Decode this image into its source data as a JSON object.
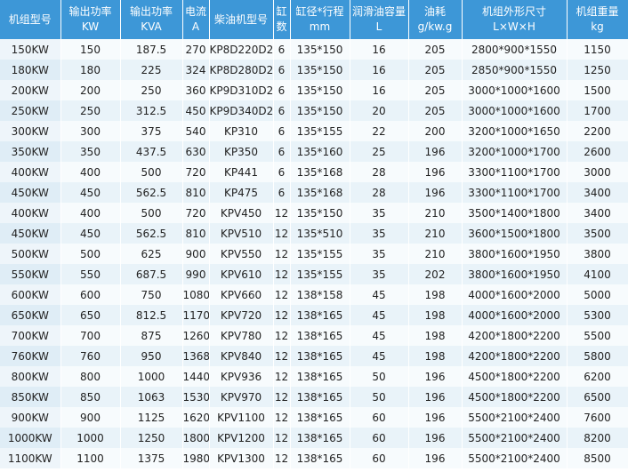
{
  "headers": [
    {
      "l1": "机组型号",
      "l2": ""
    },
    {
      "l1": "输出功率",
      "l2": "KW"
    },
    {
      "l1": "输出功率",
      "l2": "KVA"
    },
    {
      "l1": "电流",
      "l2": "A"
    },
    {
      "l1": "柴油机型号",
      "l2": ""
    },
    {
      "l1": "缸",
      "l2": "数"
    },
    {
      "l1": "缸径*行程",
      "l2": "mm"
    },
    {
      "l1": "润滑油容量",
      "l2": "L"
    },
    {
      "l1": "油耗",
      "l2": "g/kw.g"
    },
    {
      "l1": "机组外形尺寸",
      "l2": "L×W×H"
    },
    {
      "l1": "机组重量",
      "l2": "kg"
    }
  ],
  "rows": [
    [
      "150KW",
      "150",
      "187.5",
      "270",
      "KP8D220D2",
      "6",
      "135*150",
      "16",
      "205",
      "2800*900*1550",
      "1150"
    ],
    [
      "180KW",
      "180",
      "225",
      "324",
      "KP8D280D2",
      "6",
      "135*150",
      "16",
      "205",
      "2850*900*1550",
      "1250"
    ],
    [
      "200KW",
      "200",
      "250",
      "360",
      "KP9D310D2",
      "6",
      "135*150",
      "16",
      "205",
      "3000*1000*1600",
      "1500"
    ],
    [
      "250KW",
      "250",
      "312.5",
      "450",
      "KP9D340D2",
      "6",
      "135*150",
      "20",
      "205",
      "3000*1000*1600",
      "1700"
    ],
    [
      "300KW",
      "300",
      "375",
      "540",
      "KP310",
      "6",
      "135*155",
      "22",
      "200",
      "3200*1000*1650",
      "2200"
    ],
    [
      "350KW",
      "350",
      "437.5",
      "630",
      "KP350",
      "6",
      "135*160",
      "25",
      "196",
      "3200*1000*1700",
      "2600"
    ],
    [
      "400KW",
      "400",
      "500",
      "720",
      "KP441",
      "6",
      "135*168",
      "28",
      "196",
      "3300*1100*1700",
      "3000"
    ],
    [
      "450KW",
      "450",
      "562.5",
      "810",
      "KP475",
      "6",
      "135*168",
      "28",
      "196",
      "3300*1100*1700",
      "3400"
    ],
    [
      "400KW",
      "400",
      "500",
      "720",
      "KPV450",
      "12",
      "135*150",
      "35",
      "210",
      "3500*1400*1800",
      "3400"
    ],
    [
      "450KW",
      "450",
      "562.5",
      "810",
      "KPV510",
      "12",
      "135*510",
      "35",
      "210",
      "3600*1500*1800",
      "3500"
    ],
    [
      "500KW",
      "500",
      "625",
      "900",
      "KPV550",
      "12",
      "135*155",
      "35",
      "210",
      "3800*1600*1950",
      "3800"
    ],
    [
      "550KW",
      "550",
      "687.5",
      "990",
      "KPV610",
      "12",
      "135*155",
      "35",
      "202",
      "3800*1600*1950",
      "4100"
    ],
    [
      "600KW",
      "600",
      "750",
      "1080",
      "KPV660",
      "12",
      "138*158",
      "45",
      "198",
      "4000*1600*2000",
      "5000"
    ],
    [
      "650KW",
      "650",
      "812.5",
      "1170",
      "KPV720",
      "12",
      "138*165",
      "45",
      "198",
      "4000*1600*2000",
      "5300"
    ],
    [
      "700KW",
      "700",
      "875",
      "1260",
      "KPV780",
      "12",
      "138*165",
      "45",
      "198",
      "4200*1800*2200",
      "5500"
    ],
    [
      "760KW",
      "760",
      "950",
      "1368",
      "KPV840",
      "12",
      "138*165",
      "45",
      "198",
      "4200*1800*2200",
      "5800"
    ],
    [
      "800KW",
      "800",
      "1000",
      "1440",
      "KPV936",
      "12",
      "138*165",
      "50",
      "196",
      "4500*1800*2200",
      "6200"
    ],
    [
      "850KW",
      "850",
      "1063",
      "1530",
      "KPV970",
      "12",
      "138*165",
      "50",
      "196",
      "4500*1800*2200",
      "6500"
    ],
    [
      "900KW",
      "900",
      "1125",
      "1620",
      "KPV1100",
      "12",
      "138*165",
      "60",
      "196",
      "5500*2100*2400",
      "7600"
    ],
    [
      "1000KW",
      "1000",
      "1250",
      "1800",
      "KPV1200",
      "12",
      "138*165",
      "60",
      "196",
      "5500*2100*2400",
      "8200"
    ],
    [
      "1100KW",
      "1100",
      "1375",
      "1980",
      "KPV1300",
      "12",
      "138*165",
      "60",
      "196",
      "5500*2100*2400",
      "8500"
    ]
  ]
}
